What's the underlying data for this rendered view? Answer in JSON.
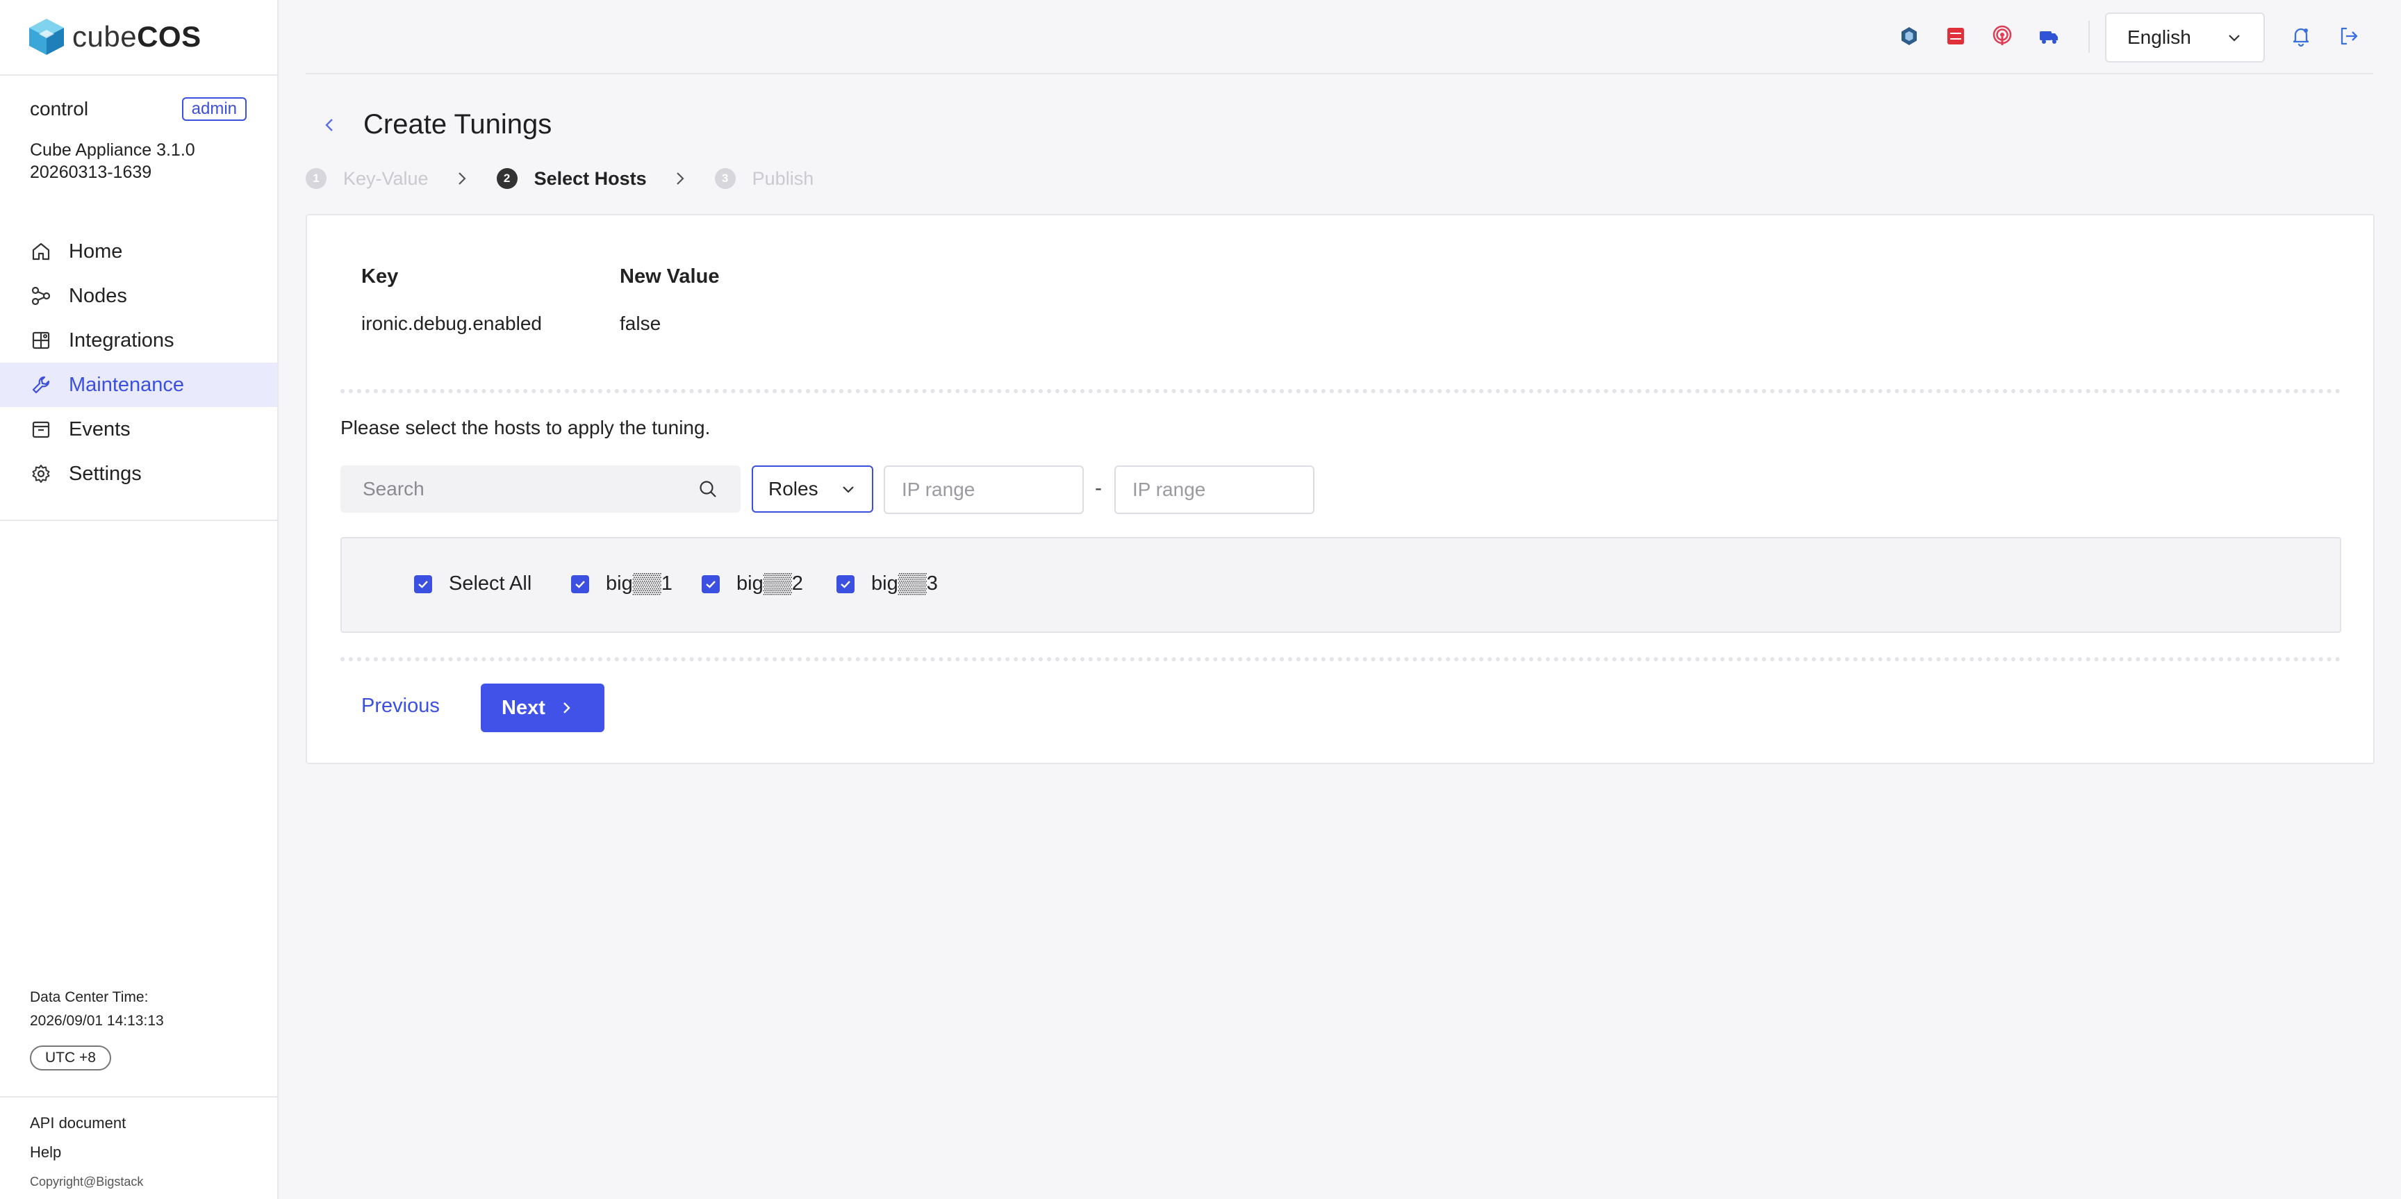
{
  "brand": {
    "name_light": "cube",
    "name_bold": "COS"
  },
  "user": {
    "name": "control",
    "role_badge": "admin"
  },
  "appliance": {
    "version": "Cube Appliance 3.1.0",
    "build": "20260313-1639"
  },
  "nav": {
    "items": [
      {
        "label": "Home",
        "icon": "home-icon"
      },
      {
        "label": "Nodes",
        "icon": "nodes-icon"
      },
      {
        "label": "Integrations",
        "icon": "integrations-icon"
      },
      {
        "label": "Maintenance",
        "icon": "maintenance-icon",
        "active": true
      },
      {
        "label": "Events",
        "icon": "events-icon"
      },
      {
        "label": "Settings",
        "icon": "gear-icon"
      }
    ]
  },
  "datacenter": {
    "label": "Data Center Time:",
    "time": "2026/09/01 14:13:13",
    "timezone": "UTC +8"
  },
  "footer": {
    "api_document": "API document",
    "help": "Help",
    "copyright": "Copyright@Bigstack"
  },
  "header": {
    "language": "English",
    "icons": [
      "hexagon-icon",
      "terminal-icon",
      "broadcast-icon",
      "truck-icon",
      "bell-icon",
      "logout-icon"
    ]
  },
  "page": {
    "title": "Create Tunings"
  },
  "steps": [
    {
      "num": "1",
      "label": "Key-Value",
      "state": "disabled"
    },
    {
      "num": "2",
      "label": "Select Hosts",
      "state": "current"
    },
    {
      "num": "3",
      "label": "Publish",
      "state": "disabled"
    }
  ],
  "tuning": {
    "key_header": "Key",
    "value_header": "New Value",
    "key": "ironic.debug.enabled",
    "value": "false"
  },
  "hosts": {
    "instruction": "Please select the hosts to apply the tuning.",
    "search_placeholder": "Search",
    "roles_label": "Roles",
    "ip_from_placeholder": "IP range",
    "ip_separator": "-",
    "ip_to_placeholder": "IP range",
    "select_all_label": "Select All",
    "items": [
      {
        "label": "big▒▒1",
        "checked": true
      },
      {
        "label": "big▒▒2",
        "checked": true
      },
      {
        "label": "big▒▒3",
        "checked": true
      }
    ]
  },
  "actions": {
    "previous": "Previous",
    "next": "Next"
  },
  "colors": {
    "accent": "#3b4fe0",
    "active_nav_bg": "#e9eafb"
  }
}
